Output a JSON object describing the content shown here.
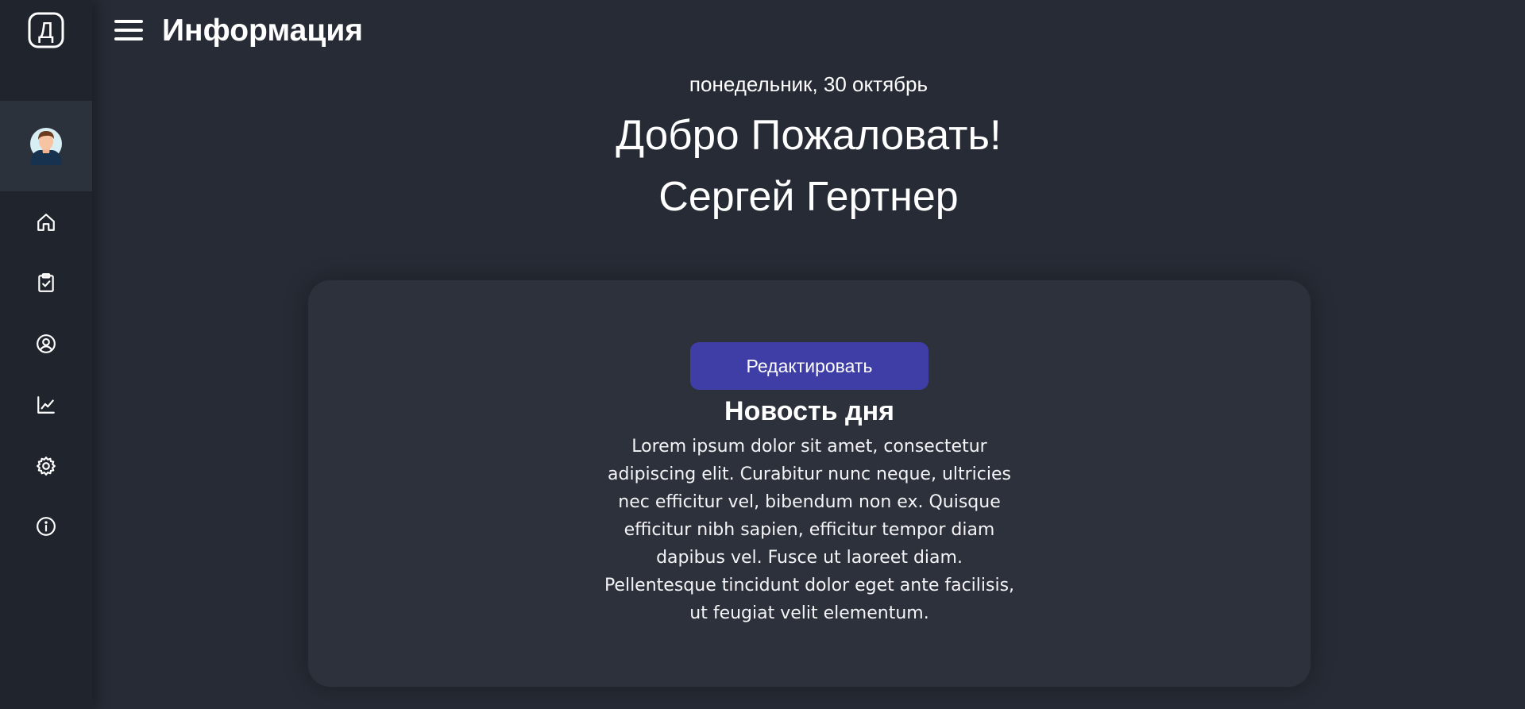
{
  "app": {
    "logo_letter": "Д",
    "logo_icon": "app-logo-icon"
  },
  "header": {
    "title": "Информация",
    "menu_icon": "hamburger-menu-icon"
  },
  "sidebar": {
    "avatar_icon": "user-avatar",
    "items": [
      {
        "name": "home",
        "icon": "home-icon"
      },
      {
        "name": "tasks",
        "icon": "clipboard-check-icon"
      },
      {
        "name": "profile",
        "icon": "user-circle-icon"
      },
      {
        "name": "statistics",
        "icon": "chart-line-icon"
      },
      {
        "name": "settings",
        "icon": "gear-icon"
      },
      {
        "name": "info",
        "icon": "info-icon"
      }
    ]
  },
  "greeting": {
    "date": "понедельник, 30 октябрь",
    "welcome": "Добро Пожаловать!",
    "user_name": "Сергей Гертнер"
  },
  "news": {
    "edit_button_label": "Редактировать",
    "title": "Новость дня",
    "text": "Lorem ipsum dolor sit amet, consectetur adipiscing elit. Curabitur nunc neque, ultricies nec efficitur vel, bibendum non ex. Quisque efficitur nibh sapien, efficitur tempor diam dapibus vel. Fusce ut laoreet diam. Pellentesque tincidunt dolor eget ante facilisis, ut feugiat velit elementum."
  },
  "colors": {
    "background": "#262b35",
    "sidebar": "#20252d",
    "card": "#2c313c",
    "accent_button": "#3f3ea6",
    "text": "#ffffff"
  }
}
